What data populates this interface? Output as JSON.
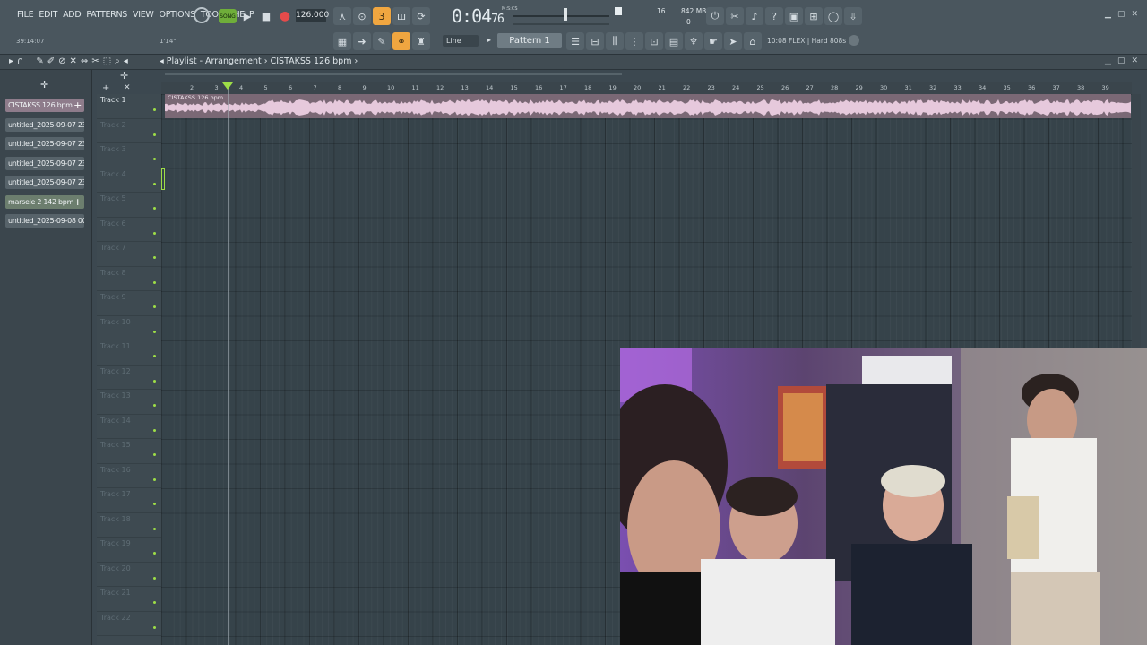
{
  "menu": [
    "FILE",
    "EDIT",
    "ADD",
    "PATTERNS",
    "VIEW",
    "OPTIONS",
    "TOOLS",
    "HELP"
  ],
  "transport": {
    "song_label": "SONG",
    "tempo": "126.000",
    "time_main": "0:04",
    "time_sub": "76",
    "time_unit": "M:S:CS"
  },
  "hint_line": {
    "pos": "39:14:07",
    "zoom": "1'14\""
  },
  "memory": {
    "mb": "842 MB",
    "cpu": "16",
    "poly": "0"
  },
  "snap_mode": "Line",
  "pattern": "Pattern 1",
  "plugin_info": "10:08  FLEX | Hard 808s",
  "playlist": {
    "title": "Playlist - Arrangement",
    "crumb_sep": "›",
    "project": "CISTAKSS",
    "project_tempo": "126 bpm"
  },
  "picker": [
    {
      "label": "CISTAKSS  126 bpm",
      "plus": "+",
      "style": "sel"
    },
    {
      "label": "untitled_2025-09-07 23-...",
      "style": ""
    },
    {
      "label": "untitled_2025-09-07 23-...",
      "style": ""
    },
    {
      "label": "untitled_2025-09-07 23-...",
      "style": ""
    },
    {
      "label": "untitled_2025-09-07 23-...",
      "style": ""
    },
    {
      "label": "marsele 2 142 bpm",
      "plus": "+",
      "style": "sel2"
    },
    {
      "label": "untitled_2025-09-08 00-...",
      "style": ""
    }
  ],
  "tracks": [
    "Track 1",
    "Track 2",
    "Track 3",
    "Track 4",
    "Track 5",
    "Track 6",
    "Track 7",
    "Track 8",
    "Track 9",
    "Track 10",
    "Track 11",
    "Track 12",
    "Track 13",
    "Track 14",
    "Track 15",
    "Track 16",
    "Track 17",
    "Track 18",
    "Track 19",
    "Track 20",
    "Track 21",
    "Track 22"
  ],
  "bars": [
    "2",
    "3",
    "4",
    "5",
    "6",
    "7",
    "8",
    "9",
    "10",
    "11",
    "12",
    "13",
    "14",
    "15",
    "16",
    "17",
    "18",
    "19",
    "20",
    "21",
    "22",
    "23",
    "24",
    "25",
    "26",
    "27",
    "28",
    "29",
    "30",
    "31",
    "32",
    "33",
    "34",
    "35",
    "36",
    "37",
    "38",
    "39"
  ],
  "clip": {
    "label": "CISTAKSS  126 bpm"
  },
  "colors": {
    "accent": "#f0a640",
    "green": "#9ede47",
    "clip": "#7a6875",
    "wave": "#e6c9dc"
  }
}
